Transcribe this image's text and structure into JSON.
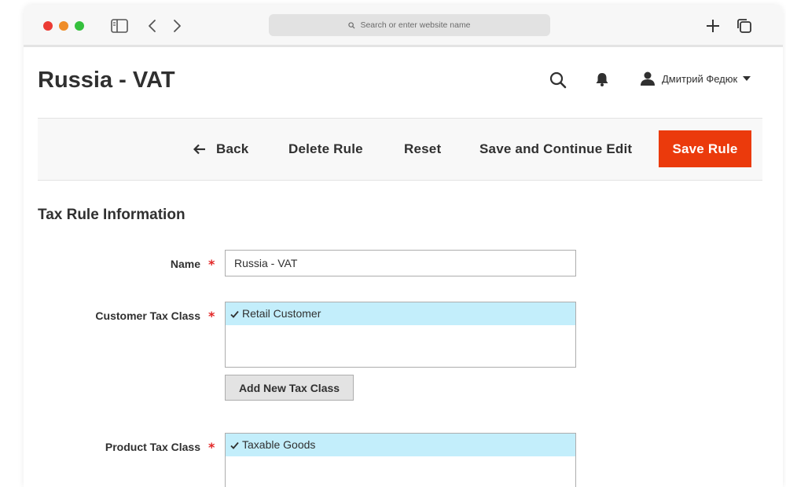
{
  "browser": {
    "address_placeholder": "Search or enter website name"
  },
  "header": {
    "page_title": "Russia - VAT",
    "user_name": "Дмитрий Федюк"
  },
  "actions": {
    "back_label": "Back",
    "delete_label": "Delete Rule",
    "reset_label": "Reset",
    "save_continue_label": "Save and Continue Edit",
    "save_label": "Save Rule"
  },
  "form": {
    "section_title": "Tax Rule Information",
    "required_mark": "*",
    "name": {
      "label": "Name",
      "value": "Russia - VAT"
    },
    "customer_tax_class": {
      "label": "Customer Tax Class",
      "selected_option": "Retail Customer"
    },
    "add_tax_class_label": "Add New Tax Class",
    "product_tax_class": {
      "label": "Product Tax Class",
      "selected_option": "Taxable Goods"
    }
  },
  "colors": {
    "primary_button": "#eb3a0c",
    "selected_option_bg": "#c3eefb",
    "required_star": "#e22626"
  },
  "icons": [
    "sidebar-icon",
    "chevron-left-icon",
    "chevron-right-icon",
    "search-icon",
    "plus-icon",
    "tabs-icon",
    "bell-icon",
    "user-icon",
    "caret-down-icon",
    "arrow-left-icon",
    "check-icon"
  ]
}
